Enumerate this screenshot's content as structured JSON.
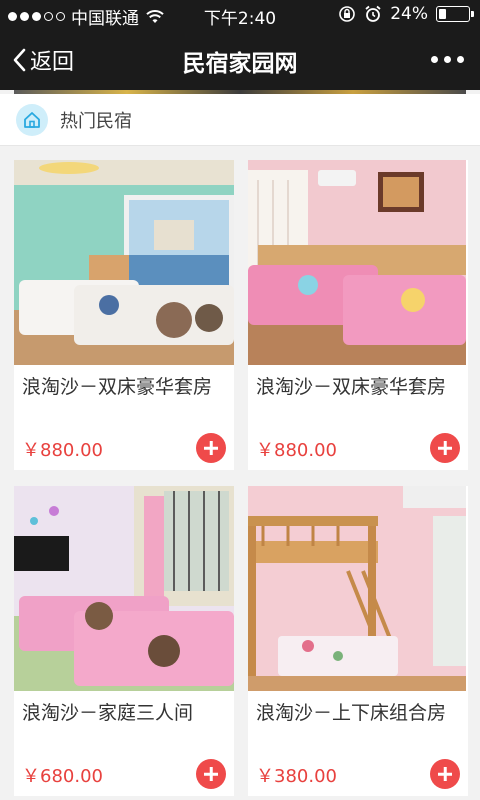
{
  "status_bar": {
    "carrier": "中国联通",
    "time": "下午2:40",
    "battery": "24%",
    "battery_level": 0.24,
    "signal_icon": "signal-dots-icon",
    "wifi_icon": "wifi-icon",
    "lock_icon": "rotation-lock-icon",
    "alarm_icon": "alarm-icon"
  },
  "nav": {
    "back_label": "返回",
    "title": "民宿家园网",
    "more_icon": "more-dots-icon"
  },
  "section": {
    "title": "热门民宿",
    "icon": "home-icon",
    "icon_color": "#29a9e0"
  },
  "listings": [
    {
      "name": "浪淘沙－双床豪华套房",
      "price": "￥880.00"
    },
    {
      "name": "浪淘沙－双床豪华套房",
      "price": "￥880.00"
    },
    {
      "name": "浪淘沙－家庭三人间",
      "price": "￥680.00"
    },
    {
      "name": "浪淘沙－上下床组合房",
      "price": "￥380.00"
    }
  ],
  "colors": {
    "price": "#e8413e",
    "add_button": "#ef4a4a",
    "nav_bg": "#1b1b1b"
  }
}
